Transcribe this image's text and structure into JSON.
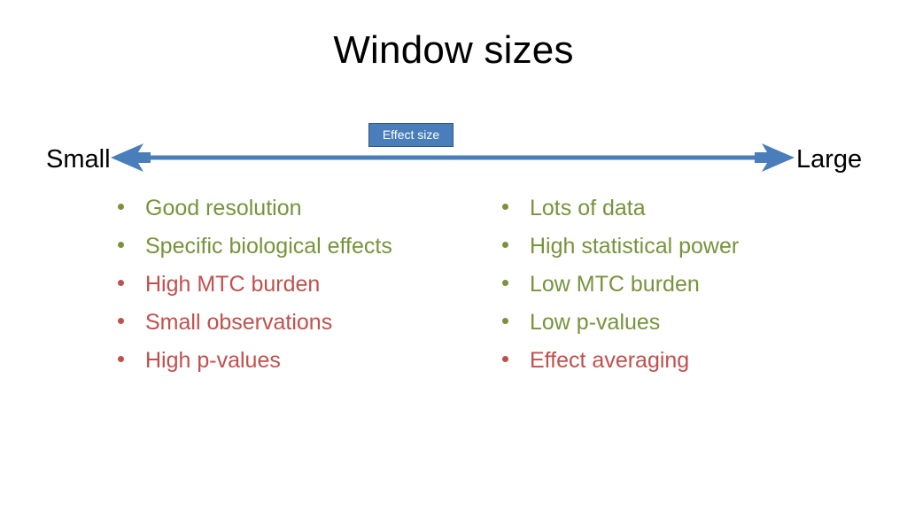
{
  "slide": {
    "title": "Window sizes",
    "background_color": "#ffffff"
  },
  "axis": {
    "badge_label": "Effect size",
    "left_label": "Small",
    "right_label": "Large",
    "arrow_color": "#4a7ebb",
    "badge_fill": "#4a7ebb",
    "badge_border": "#31557f",
    "badge_text_color": "#ffffff",
    "label_color": "#000000",
    "direction": "double-headed"
  },
  "colors": {
    "positive_green": "#77933c",
    "negative_red": "#c0504d"
  },
  "columns": {
    "left": {
      "items": [
        {
          "label": "Good resolution",
          "tone": "positive",
          "color": "#77933c"
        },
        {
          "label": "Specific biological effects",
          "tone": "positive",
          "color": "#77933c"
        },
        {
          "label": "High MTC burden",
          "tone": "negative",
          "color": "#c0504d"
        },
        {
          "label": "Small observations",
          "tone": "negative",
          "color": "#c0504d"
        },
        {
          "label": "High p-values",
          "tone": "negative",
          "color": "#c0504d"
        }
      ]
    },
    "right": {
      "items": [
        {
          "label": "Lots of data",
          "tone": "positive",
          "color": "#77933c"
        },
        {
          "label": "High statistical power",
          "tone": "positive",
          "color": "#77933c"
        },
        {
          "label": "Low MTC burden",
          "tone": "positive",
          "color": "#77933c"
        },
        {
          "label": "Low p-values",
          "tone": "positive",
          "color": "#77933c"
        },
        {
          "label": "Effect averaging",
          "tone": "negative",
          "color": "#c0504d"
        }
      ]
    }
  }
}
